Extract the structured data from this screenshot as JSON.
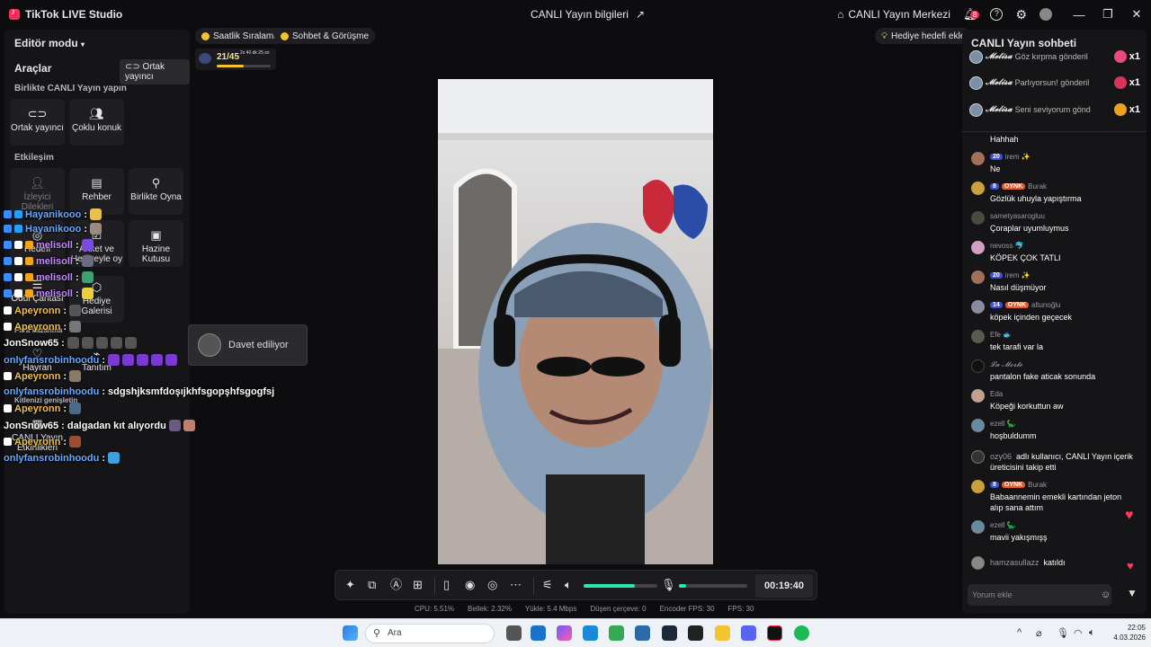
{
  "titlebar": {
    "app_name": "TikTok LIVE Studio",
    "center_title": "CANLI Yayın bilgileri",
    "live_center": "CANLI Yayın Merkezi",
    "notif_count": "8"
  },
  "left_panel": {
    "editor_mode": "Editör modu",
    "tools_title": "Araçlar",
    "cohost_button": "Ortak yayıncı",
    "section_live_together": "Birlikte CANLI Yayın yapın",
    "section_interaction": "Etkileşim",
    "tiles": {
      "cohost": "Ortak yayıncı",
      "multi_guest": "Çoklu konuk",
      "viewer_requests": "İzleyici Dilekleri",
      "guide": "Rehber",
      "play_together": "Birlikte Oyna",
      "goal": "Hedefi",
      "poll_gift": "Anket ve Hediyeyle oy",
      "treasure": "Hazine Kutusu",
      "reward_bag": "Ödül Çantası",
      "gift_gallery": "Hediye Galerisi",
      "win_label": "Para kazanma",
      "fan": "Hayran",
      "promo": "Tanıtım",
      "expand_audience": "Kitlenizi genişletin",
      "live_events": "CANLI Yayın Etkinlikleri"
    }
  },
  "overlay_chat": [
    {
      "name": "Hayanikooo",
      "text": ":"
    },
    {
      "name": "Hayanikooo",
      "text": ":"
    },
    {
      "name": "melisoll",
      "text": ":"
    },
    {
      "name": "melisoll",
      "text": ":"
    },
    {
      "name": "melisoll",
      "text": ":"
    },
    {
      "name": "melisoll",
      "text": ":"
    },
    {
      "name": "Apeyronn",
      "text": ":"
    },
    {
      "name": "Apeyronn",
      "text": ":"
    },
    {
      "name": "JonSnow65",
      "text": ":"
    },
    {
      "name": "onlyfansrobinhoodu",
      "text": ":"
    },
    {
      "name": "Apeyronn",
      "text": ":"
    },
    {
      "name": "onlyfansrobinhoodu",
      "text": ": sdgshjksmfdoşıjkhfsgopşhfsgogfsj"
    },
    {
      "name": "Apeyronn",
      "text": ":"
    },
    {
      "name": "JonSnow65",
      "text": ": dalgadan kıt alıyordu"
    },
    {
      "name": "Apeyronn",
      "text": ":"
    },
    {
      "name": "onlyfansrobinhoodu",
      "text": ":"
    }
  ],
  "stage": {
    "pill_hourly": "Saatlik Sıralama",
    "pill_chat": "Sohbet & Görüşme",
    "gift_goal": "Hediye hedefi ekle",
    "rank_value": "21/45",
    "rank_timer": "2s 40 dk 25 sn",
    "invite_text": "Davet ediliyor",
    "timer": "00:19:40",
    "volume_level": 0.7,
    "mic_level": 0.1
  },
  "stats": {
    "cpu": "CPU:  5.51%",
    "memory": "Bellek:  2.32%",
    "upload": "Yükle:  5.4 Mbps",
    "dropped": "Düşen çerçeve:  0",
    "encoder_fps": "Encoder FPS:  30",
    "fps": "FPS:  30"
  },
  "chat": {
    "title": "CANLI Yayın sohbeti",
    "gifts": [
      {
        "name": "𝓜𝓮𝓵𝓲𝓼𝓪",
        "text": "Göz kırpma gönderil",
        "count": "x1",
        "color": "#e64b7a"
      },
      {
        "name": "𝓜𝓮𝓵𝓲𝓼𝓪",
        "text": "Parlıyorsun! gönderil",
        "count": "x1",
        "color": "#d9345b"
      },
      {
        "name": "𝓜𝓮𝓵𝓲𝓼𝓪",
        "text": "Seni seviyorum gönd",
        "count": "x1",
        "color": "#f0a020"
      }
    ],
    "messages": [
      {
        "user": "",
        "text": "Hahhah"
      },
      {
        "user": "irem ✨",
        "level": "20",
        "text": "Ne"
      },
      {
        "user": "Burak",
        "level": "8",
        "fan": "OYNK",
        "text": "Gözlük uhuyla yapıştırma"
      },
      {
        "user": "sametyasarogluu",
        "text": "Çoraplar uyumluymus"
      },
      {
        "user": "nevoss 🐬",
        "text": "KÖPEK ÇOK TATLI"
      },
      {
        "user": "irem ✨",
        "level": "20",
        "text": "Nasıl düşmüyor"
      },
      {
        "user": "altunoğlu",
        "level": "14",
        "fan": "OYNK",
        "text": "köpek içinden geçecek"
      },
      {
        "user": "Efe 🐟",
        "text": "tek tarafi var la"
      },
      {
        "user": "𝓛𝓪 𝓜𝓸𝓻𝓽𝓮",
        "text": "pantalon fake aticak sonunda"
      },
      {
        "user": "Eda",
        "text": "Köpeği korkuttun aw"
      },
      {
        "user": "ezell 🦕",
        "text": "hoşbuldumm"
      },
      {
        "user": "Burak",
        "level": "8",
        "fan": "OYNK",
        "text": "Babaannemin emekli kartından jeton alıp sana attım"
      },
      {
        "user": "ezell 🦕",
        "text": "mavii yakışmışş"
      }
    ],
    "system_follow": {
      "username": "ozy06",
      "text": "adlı kullanıcı, CANLI Yayın içerik üreticisini takip etti"
    },
    "joined": {
      "username": "hamzasullazz",
      "text": "katıldı"
    },
    "comment_placeholder": "Yorum ekle"
  },
  "taskbar": {
    "search_placeholder": "Ara",
    "time": "22:05",
    "date": "4.03.2026"
  }
}
